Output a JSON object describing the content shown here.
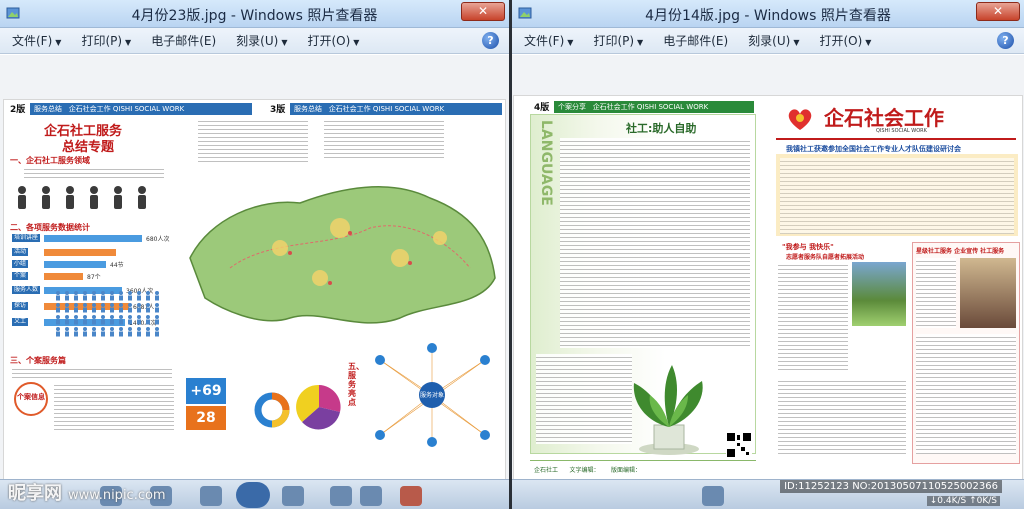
{
  "left_window": {
    "title": "4月份23版.jpg - Windows 照片查看器",
    "close_label": "✕",
    "menu": [
      {
        "label": "文件(F)",
        "caret": "▼"
      },
      {
        "label": "打印(P)",
        "caret": "▼"
      },
      {
        "label": "电子邮件(E)",
        "caret": ""
      },
      {
        "label": "刻录(U)",
        "caret": "▼"
      },
      {
        "label": "打开(O)",
        "caret": "▼"
      }
    ],
    "help_label": "?",
    "doc": {
      "page_left_num": "2版",
      "page_left_tab": "服务总结",
      "page_left_header": "企石社会工作   QISHI SOCIAL WORK",
      "page_right_num": "3版",
      "page_right_tab": "服务总结",
      "page_right_header": "企石社会工作   QISHI SOCIAL WORK",
      "headline_1": "企石社工服务",
      "headline_2": "总结专题",
      "section_1": "一、企石社工服务领域",
      "section_2": "二、各项服务数据统计",
      "section_3": "三、个案服务篇",
      "section_5": "五、服务亮点",
      "stat_rows": [
        {
          "label": "培训讲座",
          "value": "680人次",
          "fill": 0.75
        },
        {
          "label": "活动",
          "value": "",
          "fill": 0.55
        },
        {
          "label": "小组",
          "value": "44节",
          "fill": 0.48
        },
        {
          "label": "个案",
          "value": "87个",
          "fill": 0.3
        },
        {
          "label": "服务人数",
          "value": "3600人次",
          "fill": 0.6
        },
        {
          "label": "探访",
          "value": "6081人",
          "fill": 0.65
        },
        {
          "label": "义工",
          "value": "1400人次",
          "fill": 0.62
        }
      ],
      "big_num_1": "+69",
      "big_num_2": "28",
      "case_label": "个案信息",
      "service_label": "服务对象"
    }
  },
  "right_window": {
    "title": "4月份14版.jpg - Windows 照片查看器",
    "close_label": "✕",
    "menu": [
      {
        "label": "文件(F)",
        "caret": "▼"
      },
      {
        "label": "打印(P)",
        "caret": "▼"
      },
      {
        "label": "电子邮件(E)",
        "caret": ""
      },
      {
        "label": "刻录(U)",
        "caret": "▼"
      },
      {
        "label": "打开(O)",
        "caret": "▼"
      }
    ],
    "help_label": "?",
    "doc": {
      "page_num": "4版",
      "tab": "个案分享",
      "header": "企石社会工作   QISHI SOCIAL WORK",
      "vertical_text": "LANGUAGE",
      "article_title": "社工:助人自助",
      "masthead": "企石社会工作",
      "masthead_sub": "QISHI   SOCIAL   WORK",
      "news_headline": "我镇社工获邀参加全国社会工作专业人才队伍建设研讨会",
      "sub_headline_1": "\"我参与 我快乐\"",
      "sub_headline_2": "志愿者服务队自愿者拓展活动",
      "sub_headline_3": "星级社工服务 企业宣传 社工服务",
      "footer_left": "企石社工",
      "footer_mid": "文字编辑：",
      "footer_right": "版面编辑："
    }
  },
  "watermark": {
    "brand": "昵享网",
    "url": "www.nipic.com",
    "id_text": "ID:11252123 NO:20130507110525002366",
    "speed_down": "0.4K/S",
    "speed_up": "0K/S"
  },
  "colors": {
    "title_bar": "#c6ddf5",
    "menu_bar": "#e6eef8",
    "accent_blue": "#2a6db3",
    "headline_red": "#c01b1b",
    "map_green": "#9cc97a"
  }
}
